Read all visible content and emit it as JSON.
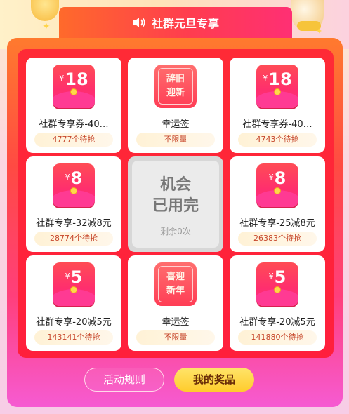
{
  "header": {
    "title": "社群元旦专享",
    "icon": "speaker-icon"
  },
  "grid": [
    {
      "type": "coupon",
      "currency": "¥",
      "amount": "18",
      "label": "社群专享券-40…",
      "pill": "4777个待抢"
    },
    {
      "type": "fortune",
      "line1": "辞旧",
      "line2": "迎新",
      "label": "幸运签",
      "pill": "不限量"
    },
    {
      "type": "coupon",
      "currency": "¥",
      "amount": "18",
      "label": "社群专享券-40…",
      "pill": "4743个待抢"
    },
    {
      "type": "coupon",
      "currency": "¥",
      "amount": "8",
      "label": "社群专享-32减8元",
      "pill": "28774个待抢"
    },
    {
      "type": "center",
      "line1": "机会",
      "line2": "已用完",
      "sub": "剩余0次"
    },
    {
      "type": "coupon",
      "currency": "¥",
      "amount": "8",
      "label": "社群专享-25减8元",
      "pill": "26383个待抢"
    },
    {
      "type": "coupon",
      "currency": "¥",
      "amount": "5",
      "label": "社群专享-20减5元",
      "pill": "143141个待抢"
    },
    {
      "type": "fortune",
      "line1": "喜迎",
      "line2": "新年",
      "label": "幸运签",
      "pill": "不限量"
    },
    {
      "type": "coupon",
      "currency": "¥",
      "amount": "5",
      "label": "社群专享-20减5元",
      "pill": "141880个待抢"
    }
  ],
  "buttons": {
    "rules": "活动规则",
    "prizes": "我的奖品"
  },
  "colors": {
    "accent": "#ff2a36",
    "prize_button": "#ffd23a",
    "pill_text": "#c7472b"
  }
}
